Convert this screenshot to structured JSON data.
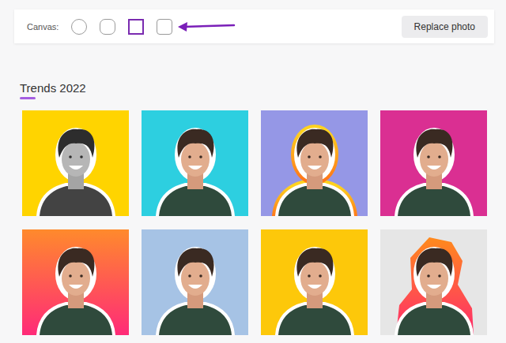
{
  "toolbar": {
    "label": "Canvas:",
    "shapes": [
      {
        "kind": "circle",
        "selected": false
      },
      {
        "kind": "rounded",
        "selected": false
      },
      {
        "kind": "square",
        "selected": true
      },
      {
        "kind": "soft",
        "selected": false
      }
    ],
    "button": "Replace photo"
  },
  "section": {
    "title": "Trends 2022"
  },
  "tiles": [
    {
      "kind": "bw",
      "colors": [
        "#ffd400"
      ]
    },
    {
      "kind": "plain",
      "colors": [
        "#2dcfe0"
      ]
    },
    {
      "kind": "outline",
      "colors": [
        "#9597e6"
      ]
    },
    {
      "kind": "plain",
      "colors": [
        "#da2f92"
      ]
    },
    {
      "kind": "plain",
      "colors": [
        "#ff8a2c",
        "#ff2a78"
      ]
    },
    {
      "kind": "plain",
      "colors": [
        "#a6c3e5"
      ]
    },
    {
      "kind": "plain",
      "colors": [
        "#fdc80a"
      ]
    },
    {
      "kind": "shape",
      "colors": [
        "#e6e6e6"
      ]
    }
  ]
}
